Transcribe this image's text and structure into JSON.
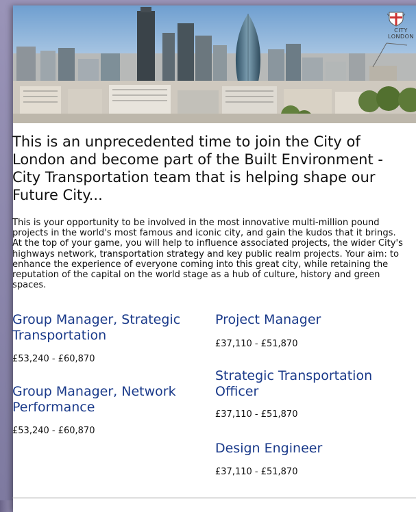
{
  "crest": {
    "line1": "CITY",
    "line2": "LONDON"
  },
  "headline": "This is an unprecedented time to join the City of London and become part of the Built Environment - City Transportation team that is helping shape our Future City...",
  "intro": "This is your opportunity to be involved in the most innovative multi-million pound projects in the world's most famous and iconic city, and gain the kudos that it brings. At the top of your game, you will help to influence associated projects, the wider City's highways network, transportation strategy and key public realm projects. Your aim: to enhance the experience of everyone coming into this great city, while retaining the reputation of the capital on the world stage as a hub of culture, history and green spaces.",
  "jobs_left": [
    {
      "title": "Group Manager, Strategic Transportation",
      "salary": "£53,240 - £60,870"
    },
    {
      "title": "Group Manager, Network Performance",
      "salary": "£53,240 - £60,870"
    }
  ],
  "jobs_right": [
    {
      "title": "Project Manager",
      "salary": "£37,110 - £51,870"
    },
    {
      "title": "Strategic Transportation Officer",
      "salary": "£37,110 - £51,870"
    },
    {
      "title": "Design Engineer",
      "salary": "£37,110 - £51,870"
    }
  ],
  "colors": {
    "job_title": "#1a3a8a",
    "frame": "#8a84a8"
  }
}
